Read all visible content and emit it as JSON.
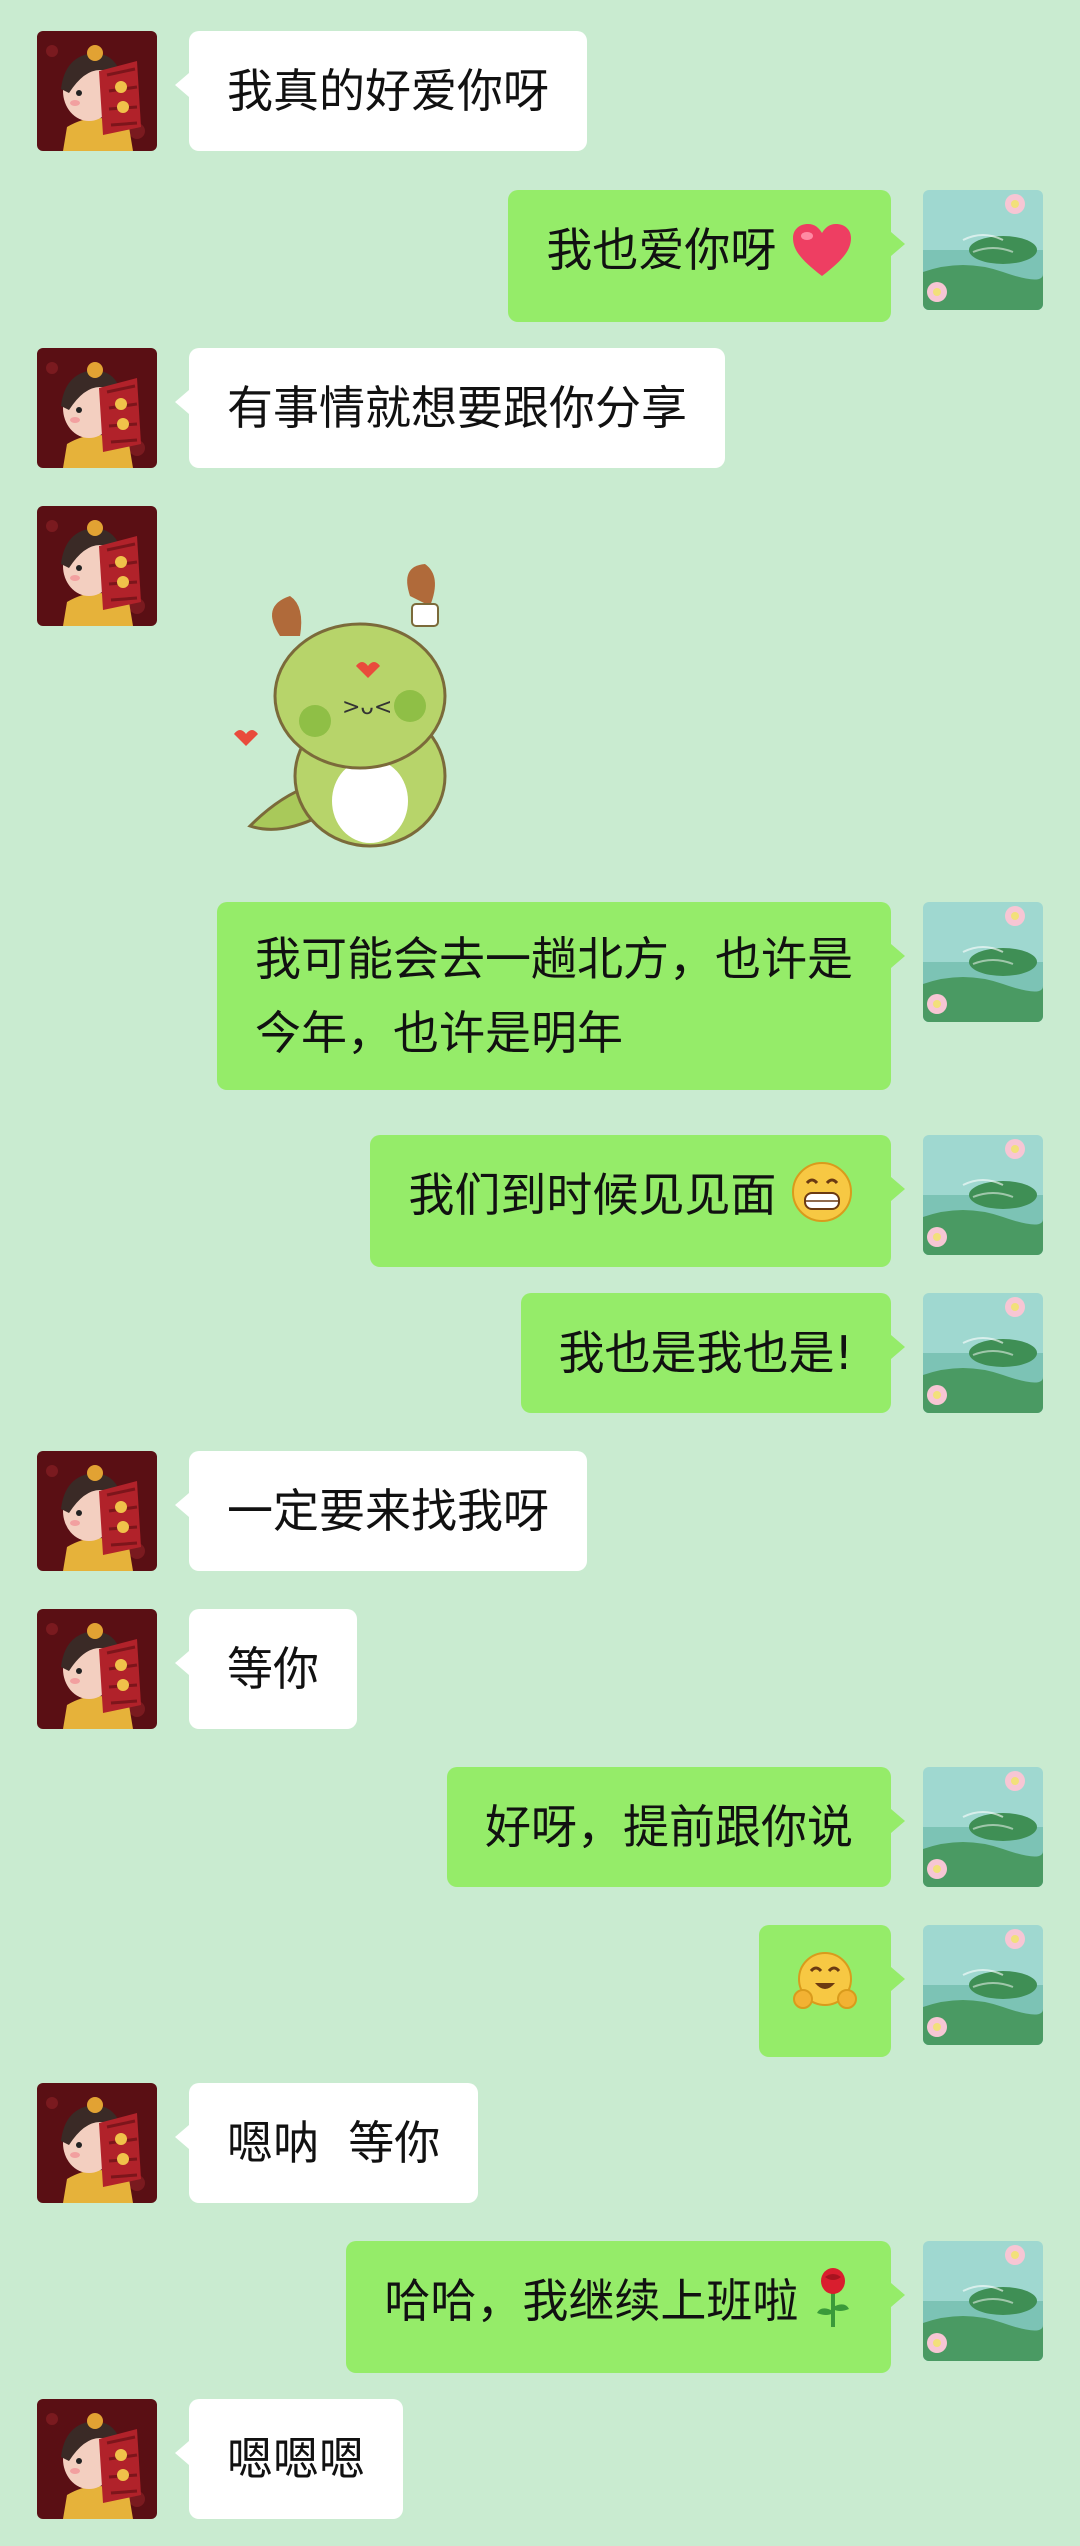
{
  "messages": [
    {
      "side": "left",
      "text": "我真的好爱你呀"
    },
    {
      "side": "right",
      "text": "我也爱你呀",
      "emoji": "heart-icon"
    },
    {
      "side": "left",
      "text": "有事情就想要跟你分享"
    },
    {
      "side": "left",
      "sticker": "green-dragon-sticker"
    },
    {
      "side": "right",
      "line1": "我可能会去一趟北方，也许是",
      "line2": "今年，也许是明年"
    },
    {
      "side": "right",
      "text": "我们到时候见见面",
      "emoji": "grin-emoji-icon"
    },
    {
      "side": "right",
      "text": "我也是我也是!"
    },
    {
      "side": "left",
      "text": "一定要来找我呀"
    },
    {
      "side": "left",
      "text": "等你"
    },
    {
      "side": "right",
      "text": "好呀，提前跟你说"
    },
    {
      "side": "right",
      "emoji": "hug-emoji-icon"
    },
    {
      "side": "left",
      "text": "嗯呐  等你"
    },
    {
      "side": "right",
      "text": "哈哈，我继续上班啦",
      "emoji": "rose-icon"
    },
    {
      "side": "left",
      "text": "嗯嗯嗯"
    }
  ],
  "colors": {
    "background": "#c9ebd0",
    "sent_bubble": "#95ec69",
    "received_bubble": "#ffffff"
  }
}
